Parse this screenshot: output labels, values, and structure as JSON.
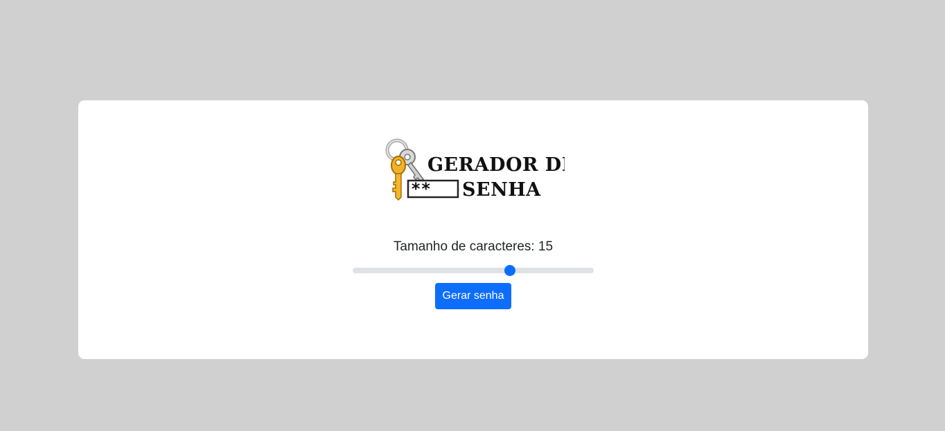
{
  "logo": {
    "line1": "GERADOR DE",
    "line2": "SENHA",
    "field_text": "**"
  },
  "length": {
    "label": "Tamanho de caracteres: 15",
    "min": 0,
    "max": 23,
    "value": 15
  },
  "button": {
    "label": "Gerar senha"
  },
  "colors": {
    "background": "#d0d0d0",
    "card": "#ffffff",
    "accent": "#0d6efd",
    "track": "#dee2e6"
  },
  "icons": {
    "logo_icon": "keys-icon"
  }
}
